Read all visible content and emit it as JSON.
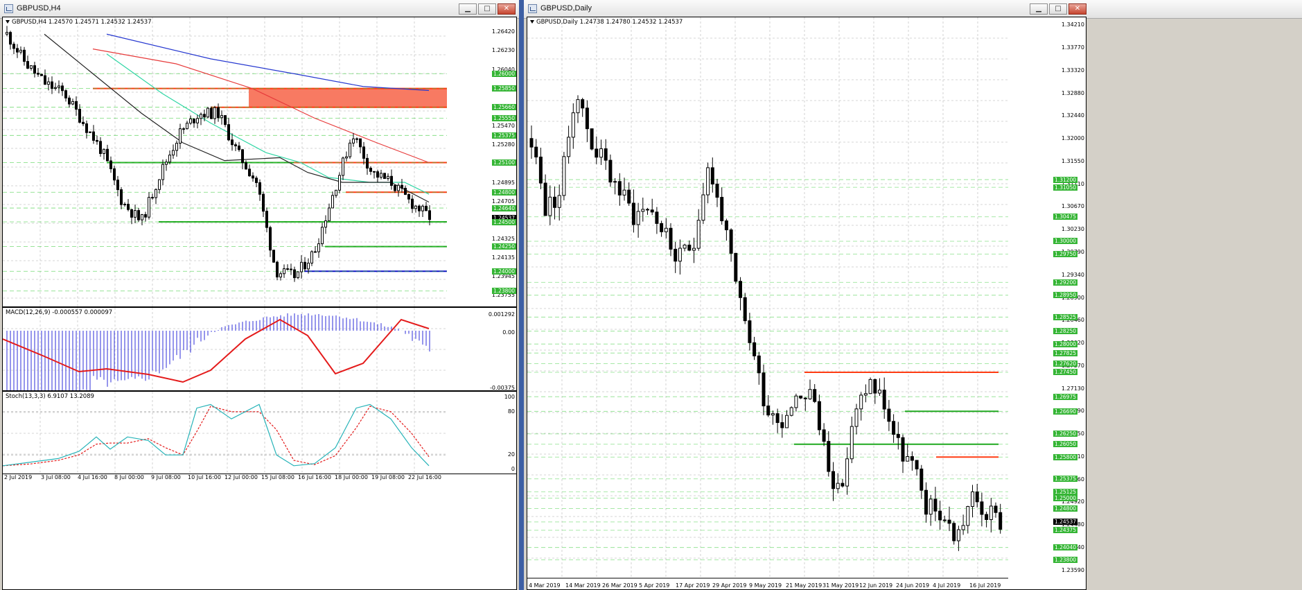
{
  "window_left": {
    "title": "GBPUSD,H4",
    "header": "GBPUSD,H4  1.24570 1.24571 1.24532 1.24537",
    "price_ticks": [
      "1.26420",
      "1.26230",
      "1.26040",
      "1.25850",
      "1.25660",
      "1.25470",
      "1.25280",
      "1.25090",
      "1.24895",
      "1.24705",
      "1.24515",
      "1.24325",
      "1.24135",
      "1.23945",
      "1.23755"
    ],
    "levels": [
      "1.26000",
      "1.25850",
      "1.25660",
      "1.25550",
      "1.25375",
      "1.25100",
      "1.24800",
      "1.24640",
      "1.24537",
      "1.24500",
      "1.24250",
      "1.24000",
      "1.23800"
    ],
    "current_price": "1.24537",
    "macd": {
      "header": "MACD(12,26,9) -0.000557 0.000097",
      "ticks": [
        "0.001292",
        "0.00",
        "-0.00375"
      ]
    },
    "stoch": {
      "header": "Stoch(13,3,3) 6.9107 13.2089",
      "ticks": [
        "100",
        "80",
        "20",
        "0"
      ]
    },
    "time_labels": [
      "2 Jul 2019",
      "3 Jul 08:00",
      "4 Jul 16:00",
      "8 Jul 00:00",
      "9 Jul 08:00",
      "10 Jul 16:00",
      "12 Jul 00:00",
      "15 Jul 08:00",
      "16 Jul 16:00",
      "18 Jul 00:00",
      "19 Jul 08:00",
      "22 Jul 16:00"
    ]
  },
  "window_right": {
    "title": "GBPUSD,Daily",
    "header": "GBPUSD,Daily  1.24738 1.24780 1.24532 1.24537",
    "price_ticks": [
      "1.34210",
      "1.33770",
      "1.33320",
      "1.32880",
      "1.32440",
      "1.32000",
      "1.31550",
      "1.31110",
      "1.30670",
      "1.30230",
      "1.29790",
      "1.29340",
      "1.28900",
      "1.28460",
      "1.28020",
      "1.27570",
      "1.27130",
      "1.26690",
      "1.26250",
      "1.25810",
      "1.25360",
      "1.24920",
      "1.24480",
      "1.24040",
      "1.23590"
    ],
    "levels": [
      "1.31200",
      "1.31050",
      "1.30475",
      "1.30000",
      "1.29750",
      "1.29200",
      "1.28950",
      "1.28525",
      "1.28250",
      "1.28000",
      "1.27825",
      "1.27620",
      "1.27450",
      "1.26975",
      "1.26690",
      "1.26250",
      "1.26050",
      "1.25800",
      "1.25375",
      "1.25125",
      "1.25000",
      "1.24800",
      "1.24537",
      "1.24375",
      "1.24040",
      "1.23800"
    ],
    "current_price": "1.24537",
    "time_labels": [
      "4 Mar 2019",
      "14 Mar 2019",
      "26 Mar 2019",
      "5 Apr 2019",
      "17 Apr 2019",
      "29 Apr 2019",
      "9 May 2019",
      "21 May 2019",
      "31 May 2019",
      "12 Jun 2019",
      "24 Jun 2019",
      "4 Jul 2019",
      "16 Jul 2019"
    ]
  },
  "window_buttons": {
    "minimize": "▁",
    "maximize": "□",
    "close": "✕"
  },
  "colors": {
    "bull": "#ffffff",
    "bear": "#000000",
    "level_green": "#1fa81f",
    "level_red": "#ff3b12",
    "level_blue": "#1010c8",
    "grid": "#c8c8c8",
    "macd_hist": "#2b2bd8",
    "macd_signal": "#e41b1b",
    "stoch_main": "#26b3b8",
    "stoch_signal": "#e41b1b",
    "ma_blue": "#2638d0",
    "ma_red": "#e73b3b",
    "ma_black": "#222222",
    "ma_cyan": "#2ed6a4"
  }
}
